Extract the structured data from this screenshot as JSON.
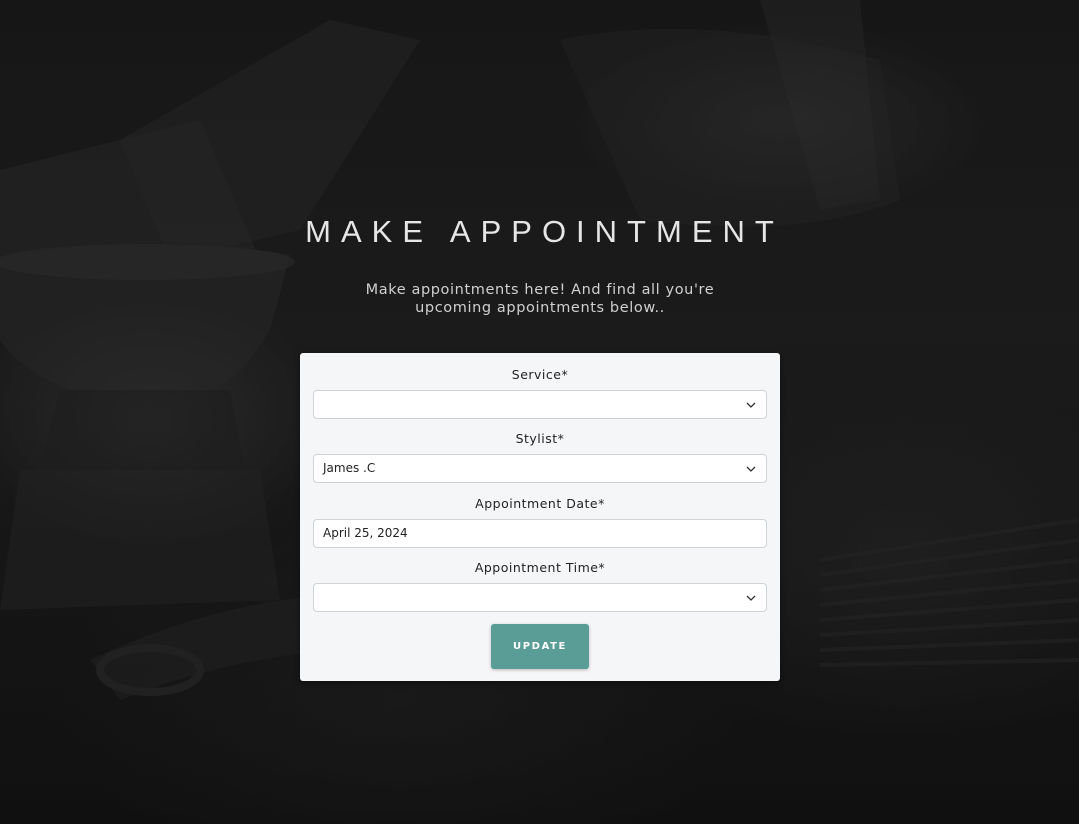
{
  "page": {
    "title": "MAKE APPOINTMENT",
    "intro": "Make appointments here! And find all you're upcoming appointments below.."
  },
  "form": {
    "service": {
      "label": "Service*",
      "value": ""
    },
    "stylist": {
      "label": "Stylist*",
      "value": "James .C"
    },
    "date": {
      "label": "Appointment Date*",
      "value": "April 25, 2024"
    },
    "time": {
      "label": "Appointment Time*",
      "value": ""
    },
    "submit_label": "UPDATE"
  },
  "colors": {
    "accent": "#5a9d96",
    "card": "#f5f6f7"
  },
  "icons": {
    "select_caret": "chevron-down-icon"
  }
}
